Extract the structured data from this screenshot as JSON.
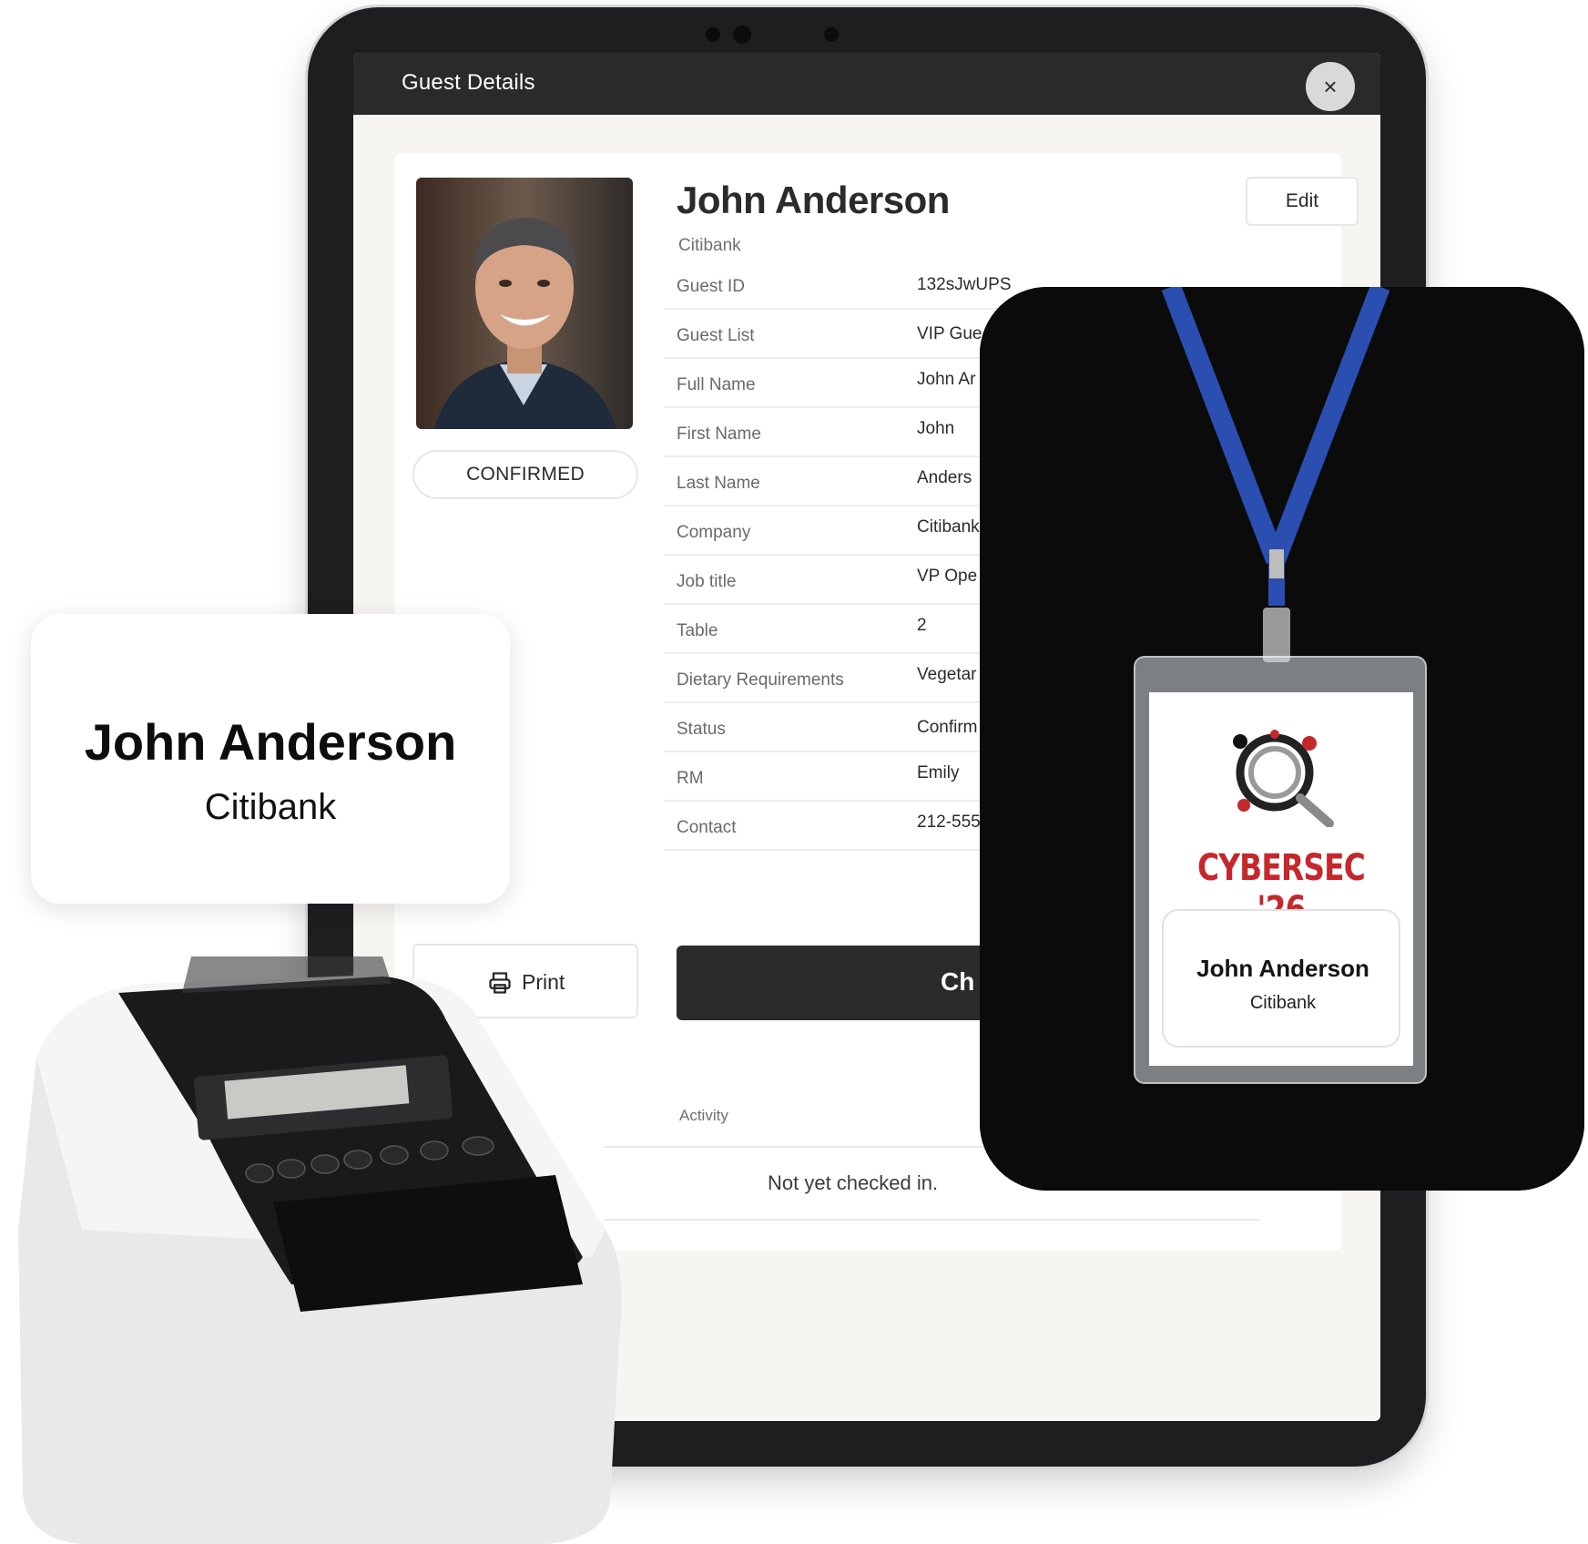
{
  "modal": {
    "title": "Guest Details",
    "close_glyph": "×"
  },
  "guest": {
    "name": "John Anderson",
    "company": "Citibank",
    "status_pill": "CONFIRMED",
    "edit_label": "Edit"
  },
  "details": [
    {
      "label": "Guest ID",
      "value": "132sJwUPS"
    },
    {
      "label": "Guest List",
      "value": "VIP Gue"
    },
    {
      "label": "Full Name",
      "value": "John Ar"
    },
    {
      "label": "First Name",
      "value": "John"
    },
    {
      "label": "Last Name",
      "value": "Anders"
    },
    {
      "label": "Company",
      "value": "Citibank"
    },
    {
      "label": "Job title",
      "value": "VP Ope"
    },
    {
      "label": "Table",
      "value": "2"
    },
    {
      "label": "Dietary Requirements",
      "value": "Vegetar"
    },
    {
      "label": "Status",
      "value": "Confirm"
    },
    {
      "label": "RM",
      "value": "Emily"
    },
    {
      "label": "Contact",
      "value": "212-555"
    }
  ],
  "actions": {
    "print_label": "Print",
    "checkin_label": "Ch"
  },
  "activity": {
    "label": "Activity",
    "empty_text": "Not yet checked in."
  },
  "name_label": {
    "name": "John Anderson",
    "company": "Citibank"
  },
  "badge": {
    "event_title": "CYBERSEC '26",
    "name": "John Anderson",
    "company": "Citibank"
  },
  "icons": [
    "close-icon",
    "print-icon",
    "magnifier-logo-icon"
  ],
  "colors": {
    "header": "#2a2a2c",
    "primary_button": "#2b2b2e",
    "badge_red": "#c4282c",
    "lanyard_blue": "#2a4fb0"
  }
}
